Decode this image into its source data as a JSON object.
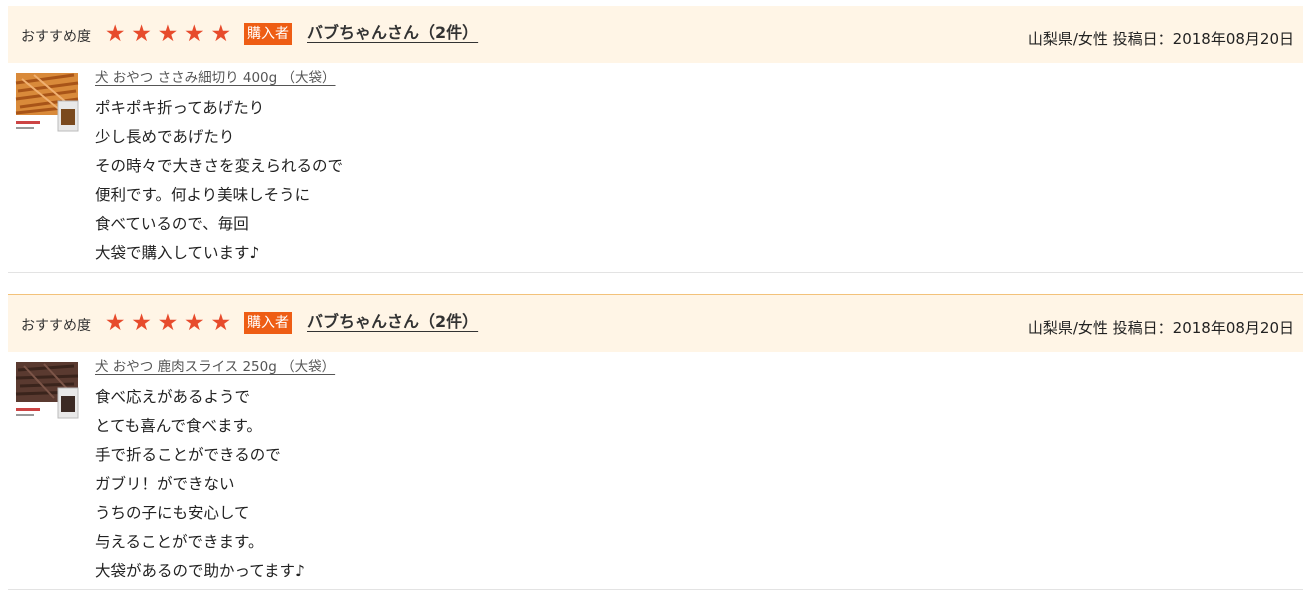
{
  "labels": {
    "recommend": "おすすめ度",
    "buyer_badge": "購入者"
  },
  "colors": {
    "header_bg": "#fff5e6",
    "star": "#e74b2c",
    "buyer_badge": "#ee5d14",
    "separator": "#f3c27a"
  },
  "reviews": [
    {
      "rating": 5,
      "stars": [
        "★",
        "★",
        "★",
        "★",
        "★"
      ],
      "user": "バブちゃんさん（2件）",
      "meta": "山梨県/女性 投稿日：2018年08月20日",
      "product": "犬 おやつ ささみ細切り 400g （大袋）",
      "thumb_icon": "chicken-jerky-package",
      "comment": [
        "ポキポキ折ってあげたり",
        "少し長めであげたり",
        "その時々で大きさを変えられるので",
        "便利です。何より美味しそうに",
        "食べているので、毎回",
        "大袋で購入しています♪"
      ]
    },
    {
      "rating": 5,
      "stars": [
        "★",
        "★",
        "★",
        "★",
        "★"
      ],
      "user": "バブちゃんさん（2件）",
      "meta": "山梨県/女性 投稿日：2018年08月20日",
      "product": "犬 おやつ 鹿肉スライス 250g （大袋）",
      "thumb_icon": "venison-slice-package",
      "comment": [
        "食べ応えがあるようで",
        "とても喜んで食べます。",
        "手で折ることができるので",
        "ガブリ！ができない",
        "うちの子にも安心して",
        "与えることができます。",
        "大袋があるので助かってます♪"
      ]
    }
  ]
}
